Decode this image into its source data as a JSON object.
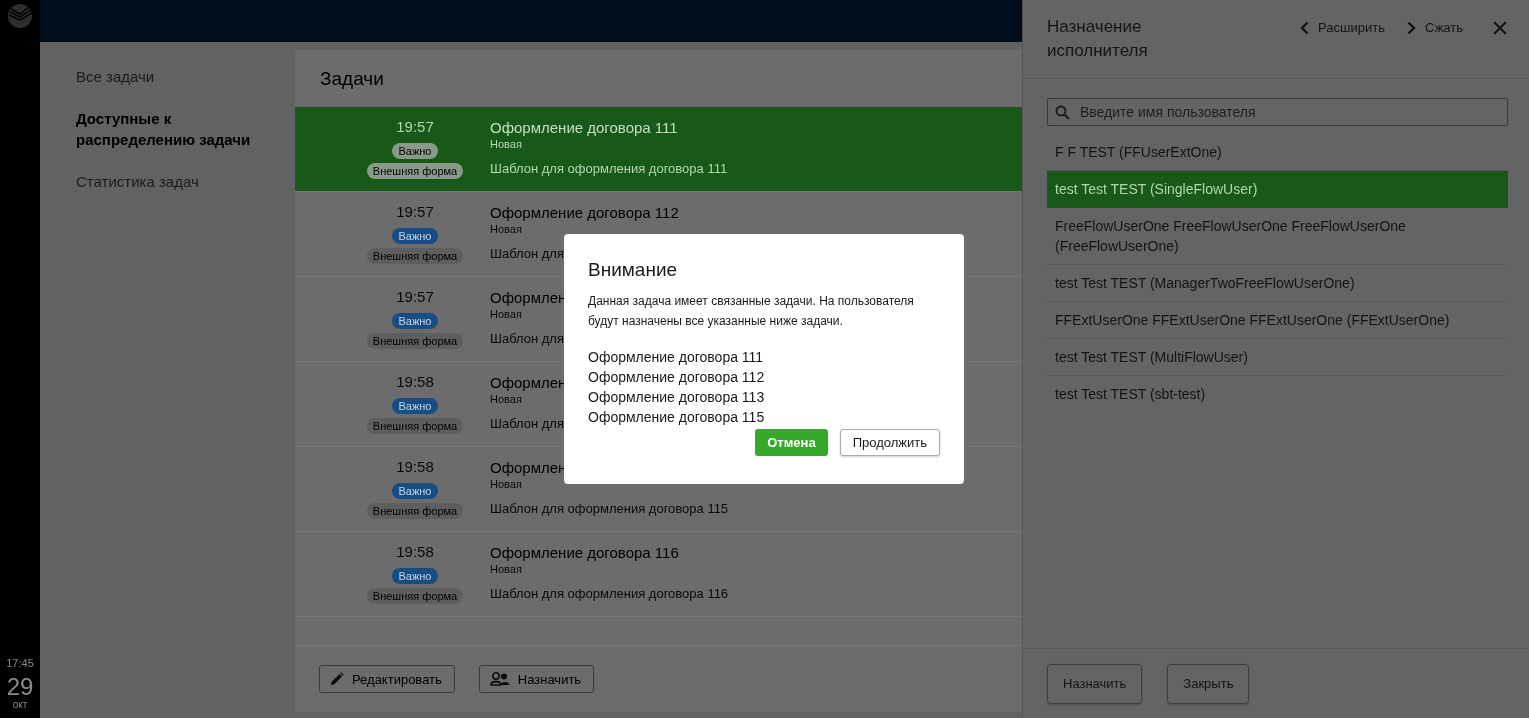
{
  "rail": {
    "time": "17:45",
    "day": "29",
    "month": "окт"
  },
  "sidebar": {
    "items": [
      {
        "label": "Все задачи",
        "selected": false
      },
      {
        "label": "Доступные к распределению задачи",
        "selected": true
      },
      {
        "label": "Статистика задач",
        "selected": false
      }
    ]
  },
  "tasks": {
    "title": "Задачи",
    "rows": [
      {
        "time": "19:57",
        "badges": [
          {
            "kind": "priority",
            "label": "Важно"
          },
          {
            "kind": "form",
            "label": "Внешняя форма"
          }
        ],
        "title": "Оформление договора 111",
        "status": "Новая",
        "template": "Шаблон для оформления договора 111",
        "selected": true
      },
      {
        "time": "19:57",
        "badges": [
          {
            "kind": "priority",
            "label": "Важно"
          },
          {
            "kind": "form",
            "label": "Внешняя форма"
          }
        ],
        "title": "Оформление договора 112",
        "status": "Новая",
        "template": "Шаблон для",
        "selected": false
      },
      {
        "time": "19:57",
        "badges": [
          {
            "kind": "priority",
            "label": "Важно"
          },
          {
            "kind": "form",
            "label": "Внешняя форма"
          }
        ],
        "title": "Оформлен",
        "status": "Новая",
        "template": "Шаблон для",
        "selected": false
      },
      {
        "time": "19:58",
        "badges": [
          {
            "kind": "priority",
            "label": "Важно"
          },
          {
            "kind": "form",
            "label": "Внешняя форма"
          }
        ],
        "title": "Оформлен",
        "status": "Новая",
        "template": "Шаблон для",
        "selected": false
      },
      {
        "time": "19:58",
        "badges": [
          {
            "kind": "priority",
            "label": "Важно"
          },
          {
            "kind": "form",
            "label": "Внешняя форма"
          }
        ],
        "title": "Оформлен",
        "status": "Новая",
        "template": "Шаблон для оформления договора 115",
        "selected": false
      },
      {
        "time": "19:58",
        "badges": [
          {
            "kind": "priority",
            "label": "Важно"
          },
          {
            "kind": "form",
            "label": "Внешняя форма"
          }
        ],
        "title": "Оформление договора 116",
        "status": "Новая",
        "template": "Шаблон для оформления договора 116",
        "selected": false
      }
    ],
    "buttons": [
      {
        "kind": "edit",
        "label": "Редактировать"
      },
      {
        "kind": "assign",
        "label": "Назначить"
      }
    ]
  },
  "panel": {
    "title": "Назначение исполнителя",
    "actions": [
      {
        "kind": "expand",
        "label": "Расширить"
      },
      {
        "kind": "shrink",
        "label": "Сжать"
      },
      {
        "kind": "close"
      }
    ],
    "search": {
      "placeholder": "Введите имя пользователя"
    },
    "users": [
      {
        "name": "F F TEST (FFUserExtOne)",
        "selected": false
      },
      {
        "name": "test Test TEST (SingleFlowUser)",
        "selected": true
      },
      {
        "name": "FreeFlowUserOne FreeFlowUserOne FreeFlowUserOne (FreeFlowUserOne)",
        "selected": false
      },
      {
        "name": "test Test TEST (ManagerTwoFreeFlowUserOne)",
        "selected": false
      },
      {
        "name": "FFExtUserOne FFExtUserOne FFExtUserOne (FFExtUserOne)",
        "selected": false
      },
      {
        "name": "test Test TEST (MultiFlowUser)",
        "selected": false
      },
      {
        "name": "test Test TEST (sbt-test)",
        "selected": false
      }
    ],
    "buttons": [
      "Назначить",
      "Закрыть"
    ]
  },
  "dialog": {
    "title": "Внимание",
    "message": "Данная задача имеет связанные задачи. На пользователя будут назначены все указанные ниже задачи.",
    "tasks": [
      "Оформление договора 111",
      "Оформление договора 112",
      "Оформление договора 113",
      "Оформление договора 115"
    ],
    "buttons": [
      {
        "kind": "primary",
        "label": "Отмена"
      },
      {
        "kind": "secondary",
        "label": "Продолжить"
      }
    ]
  }
}
